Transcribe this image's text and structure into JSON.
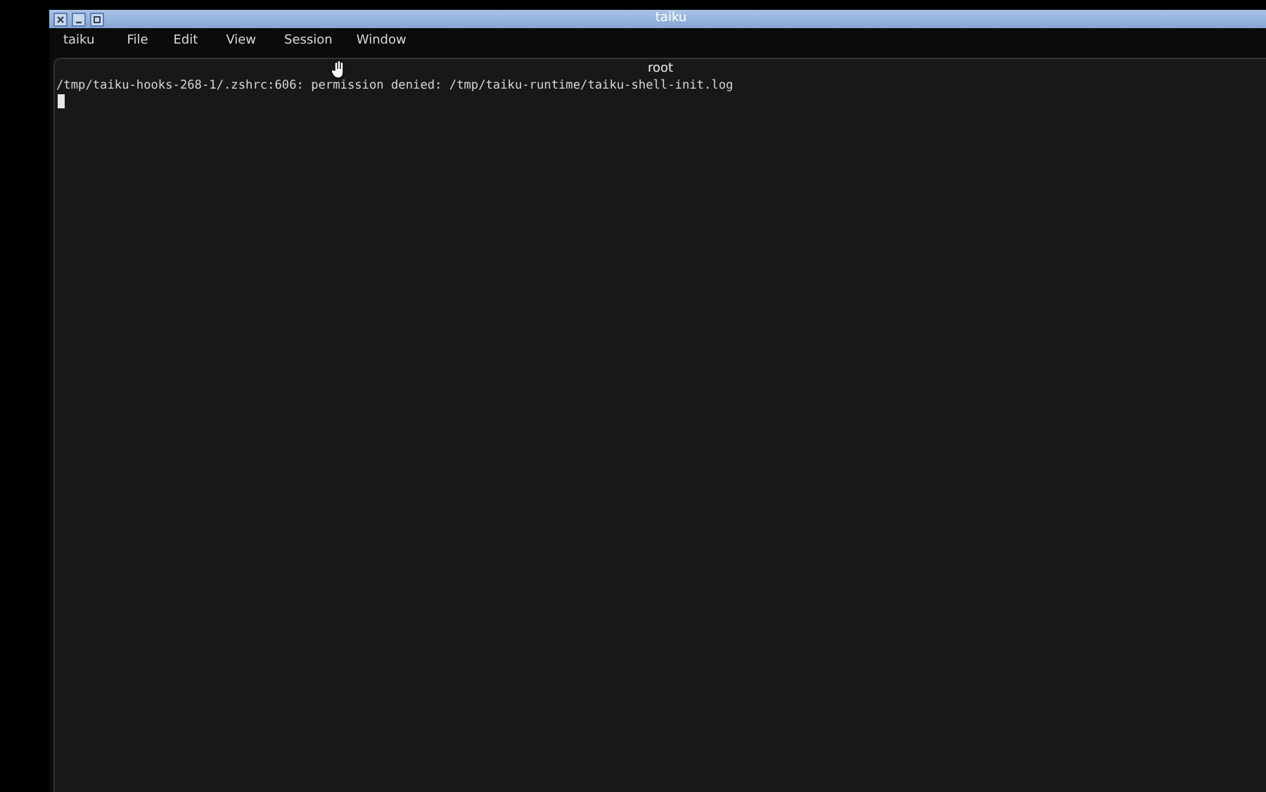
{
  "window": {
    "title": "taiku"
  },
  "menu": [
    "taiku",
    "File",
    "Edit",
    "View",
    "Session",
    "Window"
  ],
  "terminal": {
    "tab_title": "root",
    "lines": [
      "/tmp/taiku-hooks-268-1/.zshrc:606: permission denied: /tmp/taiku-runtime/taiku-shell-init.log"
    ],
    "cursor": true
  }
}
